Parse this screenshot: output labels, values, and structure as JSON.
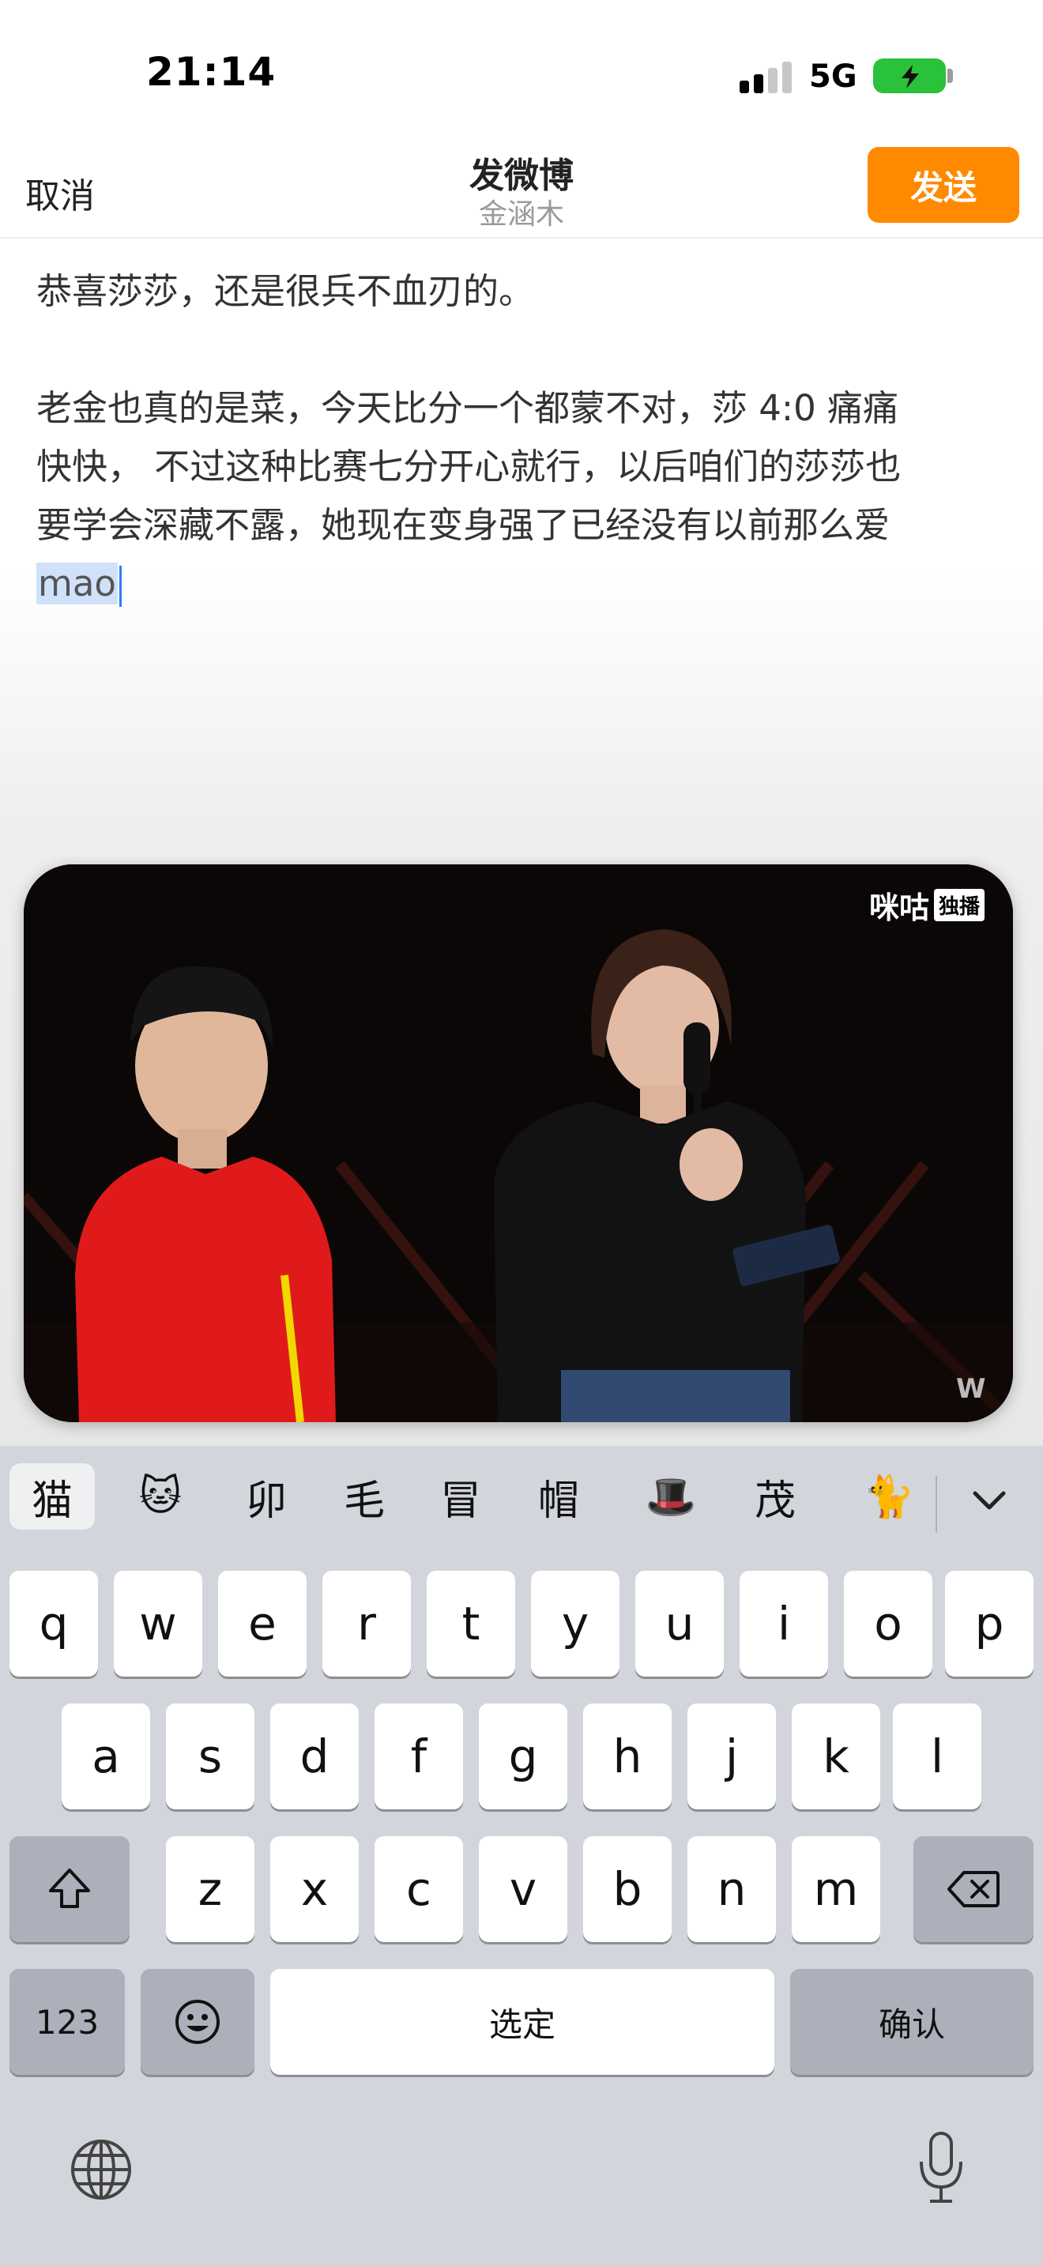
{
  "status_bar": {
    "time": "21:14",
    "network": "5G"
  },
  "nav": {
    "cancel": "取消",
    "title": "发微博",
    "subtitle": "金涵木",
    "send": "发送"
  },
  "post": {
    "line1": "恭喜莎莎，还是很兵不血刃的。",
    "line2": "老金也真的是菜，今天比分一个都蒙不对，莎 4:0 痛痛",
    "line3": "快快， 不过这种比赛七分开心就行，以后咱们的莎莎也",
    "line4": "要学会深藏不露，她现在变身强了已经没有以前那么爱",
    "marked_text": "mao"
  },
  "video": {
    "brand": "咪咕",
    "brand_tag": "独播"
  },
  "keyboard": {
    "candidates": [
      "猫",
      "🐱",
      "卯",
      "毛",
      "冒",
      "帽",
      "🎩",
      "茂",
      "🐈"
    ],
    "row1": [
      "q",
      "w",
      "e",
      "r",
      "t",
      "y",
      "u",
      "i",
      "o",
      "p"
    ],
    "row2": [
      "a",
      "s",
      "d",
      "f",
      "g",
      "h",
      "j",
      "k",
      "l"
    ],
    "row3": [
      "z",
      "x",
      "c",
      "v",
      "b",
      "n",
      "m"
    ],
    "numbers_key": "123",
    "space_label": "选定",
    "return_label": "确认"
  },
  "colors": {
    "accent": "#ff8a00",
    "caret": "#2f7cf6",
    "battery": "#2ac23a"
  },
  "icons": [
    "signal-icon",
    "battery-charging-icon",
    "chevron-down-icon",
    "shift-icon",
    "delete-icon",
    "emoji-icon",
    "globe-icon",
    "microphone-icon"
  ]
}
